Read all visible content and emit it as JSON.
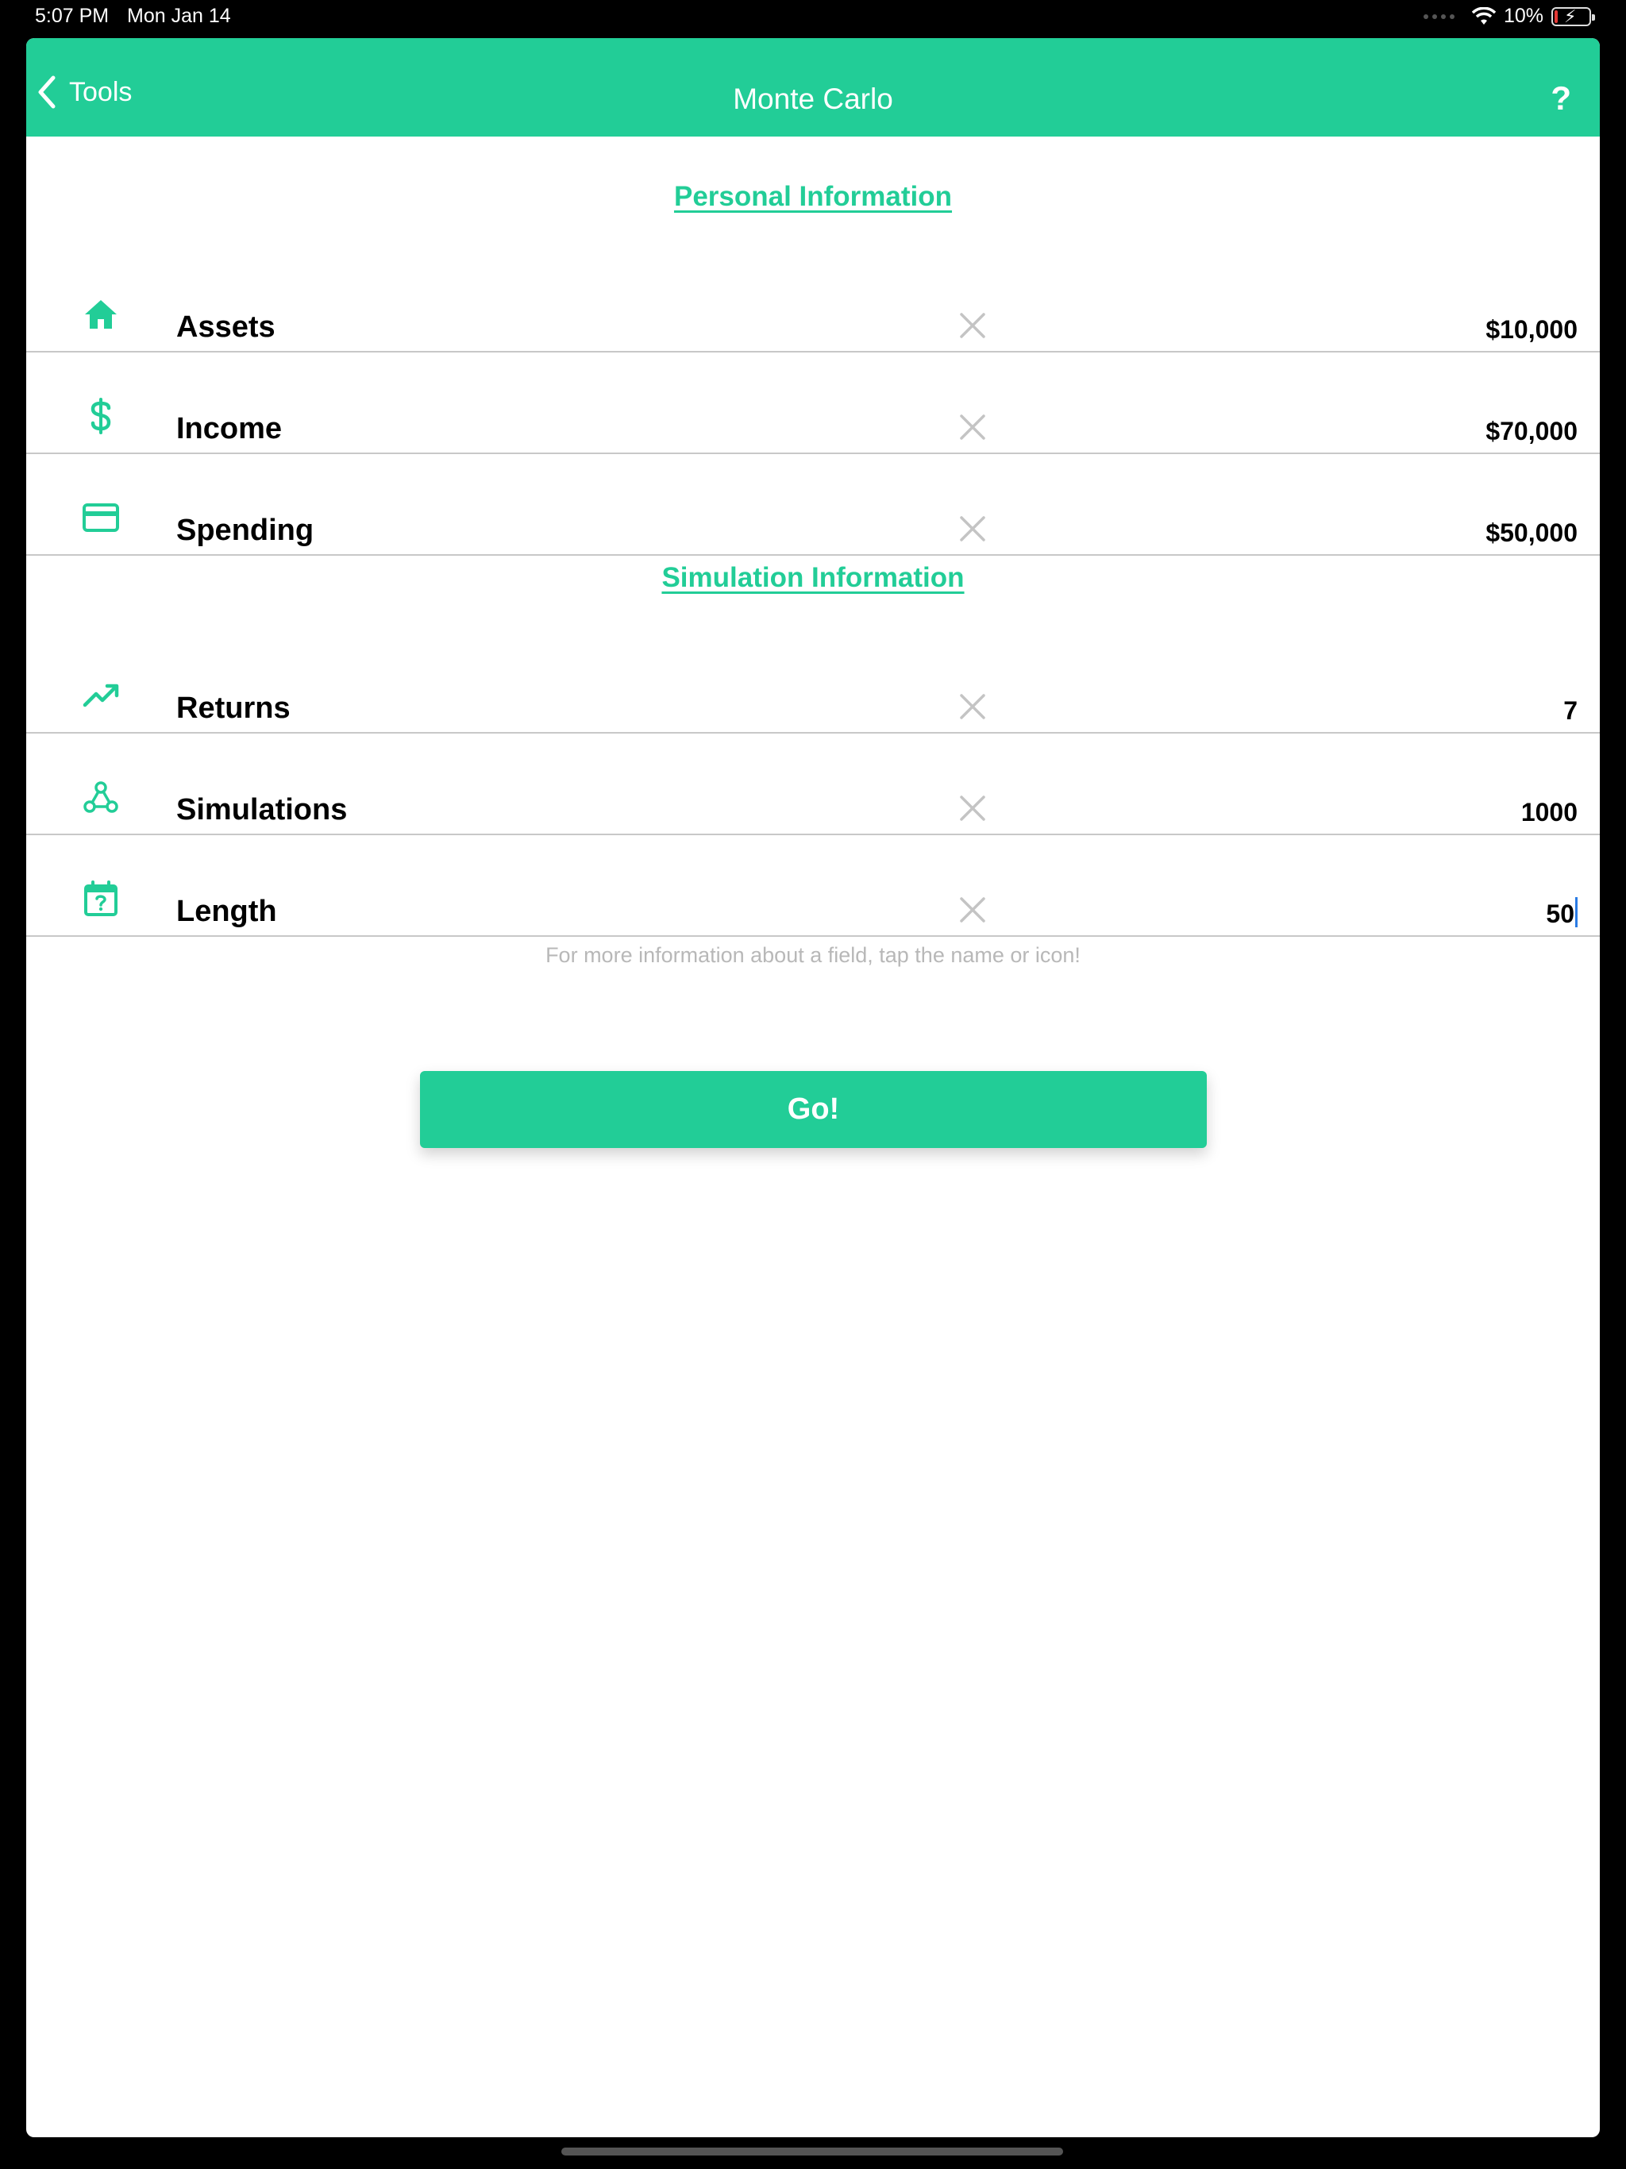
{
  "status_bar": {
    "time": "5:07 PM",
    "date": "Mon Jan 14",
    "battery_percent": "10%",
    "battery_level": 0.1
  },
  "nav": {
    "back_label": "Tools",
    "title": "Monte Carlo",
    "help_label": "?"
  },
  "sections": {
    "personal_title": "Personal Information",
    "simulation_title": "Simulation Information"
  },
  "fields": {
    "assets": {
      "label": "Assets",
      "value": "$10,000",
      "icon": "home-icon"
    },
    "income": {
      "label": "Income",
      "value": "$70,000",
      "icon": "dollar-icon"
    },
    "spending": {
      "label": "Spending",
      "value": "$50,000",
      "icon": "credit-card-icon"
    },
    "returns": {
      "label": "Returns",
      "value": "7",
      "icon": "trending-up-icon"
    },
    "simulations": {
      "label": "Simulations",
      "value": "1000",
      "icon": "webhook-icon"
    },
    "length": {
      "label": "Length",
      "value": "50",
      "icon": "calendar-question-icon"
    }
  },
  "hint_text": "For more information about a field, tap the name or icon!",
  "go_label": "Go!",
  "colors": {
    "accent": "#22cd97",
    "divider": "#c8c8c8",
    "clear_icon": "#c4c4c4",
    "hint": "#b8b8b8"
  }
}
